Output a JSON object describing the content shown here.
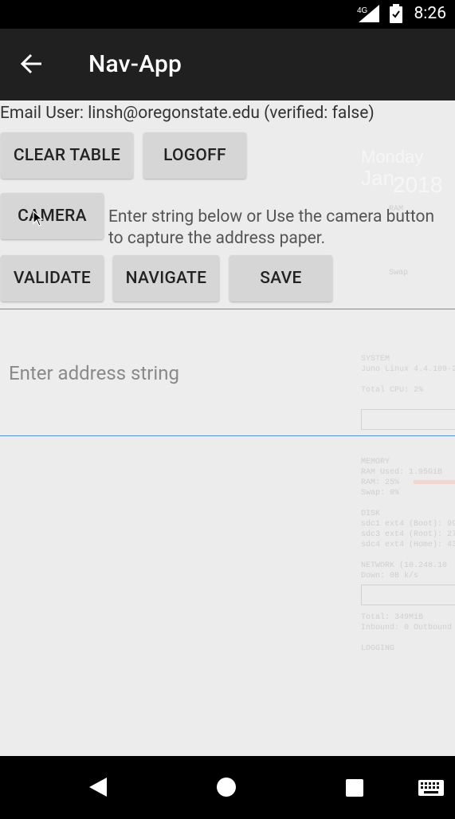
{
  "status_bar": {
    "network": "4G",
    "time": "8:26"
  },
  "app_bar": {
    "title": "Nav-App"
  },
  "user": {
    "email_line": "Email User: linsh@oregonstate.edu (verified: false)"
  },
  "buttons": {
    "clear_table": "CLEAR TABLE",
    "logoff": "LOGOFF",
    "camera": "CAMERA",
    "validate": "VALIDATE",
    "navigate": "NAVIGATE",
    "save": "SAVE"
  },
  "hint": {
    "line1": "Enter string below or Use the camera button",
    "line2": "to capture the address paper."
  },
  "address_input": {
    "placeholder": "Enter address string",
    "value": ""
  },
  "background_overlay": {
    "day": "Monday",
    "month": "Jan",
    "year": "2018",
    "ram": "RAM",
    "swap": "Swap",
    "system_label": "SYSTEM",
    "system_info": "Juno Linux 4.4.109-2-l",
    "total_cpu": "Total CPU: 2%",
    "memory_label": "MEMORY",
    "ram_used": "RAM Used: 1.95GiB",
    "ram_pct": "RAM: 25%",
    "swap_pct": "Swap: 0%",
    "disk_label": "DISK",
    "disk1": "sdc1 ext4 (Boot): 99%",
    "disk2": "sdc3 ext4 (Root): 27%",
    "disk3": "sdc4 ext4 (Home): 43",
    "network_label": "NETWORK (10.248.10",
    "down": "Down: 0B  k/s",
    "total": "Total: 349MiB",
    "inbound": "Inbound: 0 Outbound",
    "logging_label": "LOGGING"
  },
  "nav_bar": {
    "back": "back-icon",
    "home": "home-icon",
    "recents": "recents-icon",
    "keyboard": "keyboard-icon"
  }
}
